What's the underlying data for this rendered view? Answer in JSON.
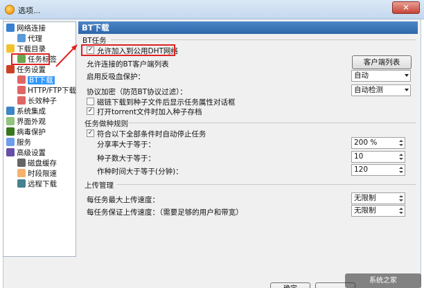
{
  "window": {
    "title": "选项..."
  },
  "tree": [
    {
      "label": "网络连接",
      "icon": "network-icon"
    },
    {
      "label": "代理",
      "icon": "proxy-icon"
    },
    {
      "label": "下载目录",
      "icon": "folder-icon"
    },
    {
      "label": "任务标签",
      "icon": "tag-icon"
    },
    {
      "label": "任务设置",
      "icon": "task-settings-icon"
    },
    {
      "label": "BT下载",
      "icon": "bt-icon"
    },
    {
      "label": "HTTP/FTP下载",
      "icon": "http-ftp-icon"
    },
    {
      "label": "长效种子",
      "icon": "seed-icon"
    },
    {
      "label": "系统集成",
      "icon": "system-icon"
    },
    {
      "label": "界面外观",
      "icon": "appearance-icon"
    },
    {
      "label": "病毒保护",
      "icon": "shield-icon"
    },
    {
      "label": "服务",
      "icon": "service-icon"
    },
    {
      "label": "高级设置",
      "icon": "advanced-icon"
    },
    {
      "label": "磁盘缓存",
      "icon": "disk-icon"
    },
    {
      "label": "时段限速",
      "icon": "clock-icon"
    },
    {
      "label": "远程下载",
      "icon": "remote-icon"
    }
  ],
  "panel": {
    "title": "BT下载",
    "bt_section": "BT任务",
    "dht_label": "允许加入到公用DHT网络",
    "client_list_label": "允许连接的BT客户端列表",
    "client_list_button": "客户端列表",
    "anti_leech_label": "启用反吸血保护：",
    "anti_leech_value": "自动",
    "encryption_label": "协议加密（防范BT协议过滤）：",
    "encryption_value": "自动检测",
    "magnet_label": "磁链下载到种子文件后显示任务属性对话框",
    "torrent_label": "打开torrent文件时加入种子存档",
    "seed_section": "任务做种规则",
    "auto_stop_label": "符合以下全部条件时自动停止任务",
    "share_ratio_label": "分享率大于等于：",
    "share_ratio_value": "200 %",
    "seeds_label": "种子数大于等于：",
    "seeds_value": "10",
    "seed_time_label": "作种时间大于等于(分钟)：",
    "seed_time_value": "120",
    "upload_section": "上传管理",
    "max_upload_label": "每任务最大上传速度：",
    "max_upload_value": "无限制",
    "guaranteed_upload_label": "每任务保证上传速度：（需要足够的用户和带宽）",
    "guaranteed_upload_value": "无限制"
  },
  "buttons": {
    "ok": "确定"
  },
  "watermark": "系统之家"
}
